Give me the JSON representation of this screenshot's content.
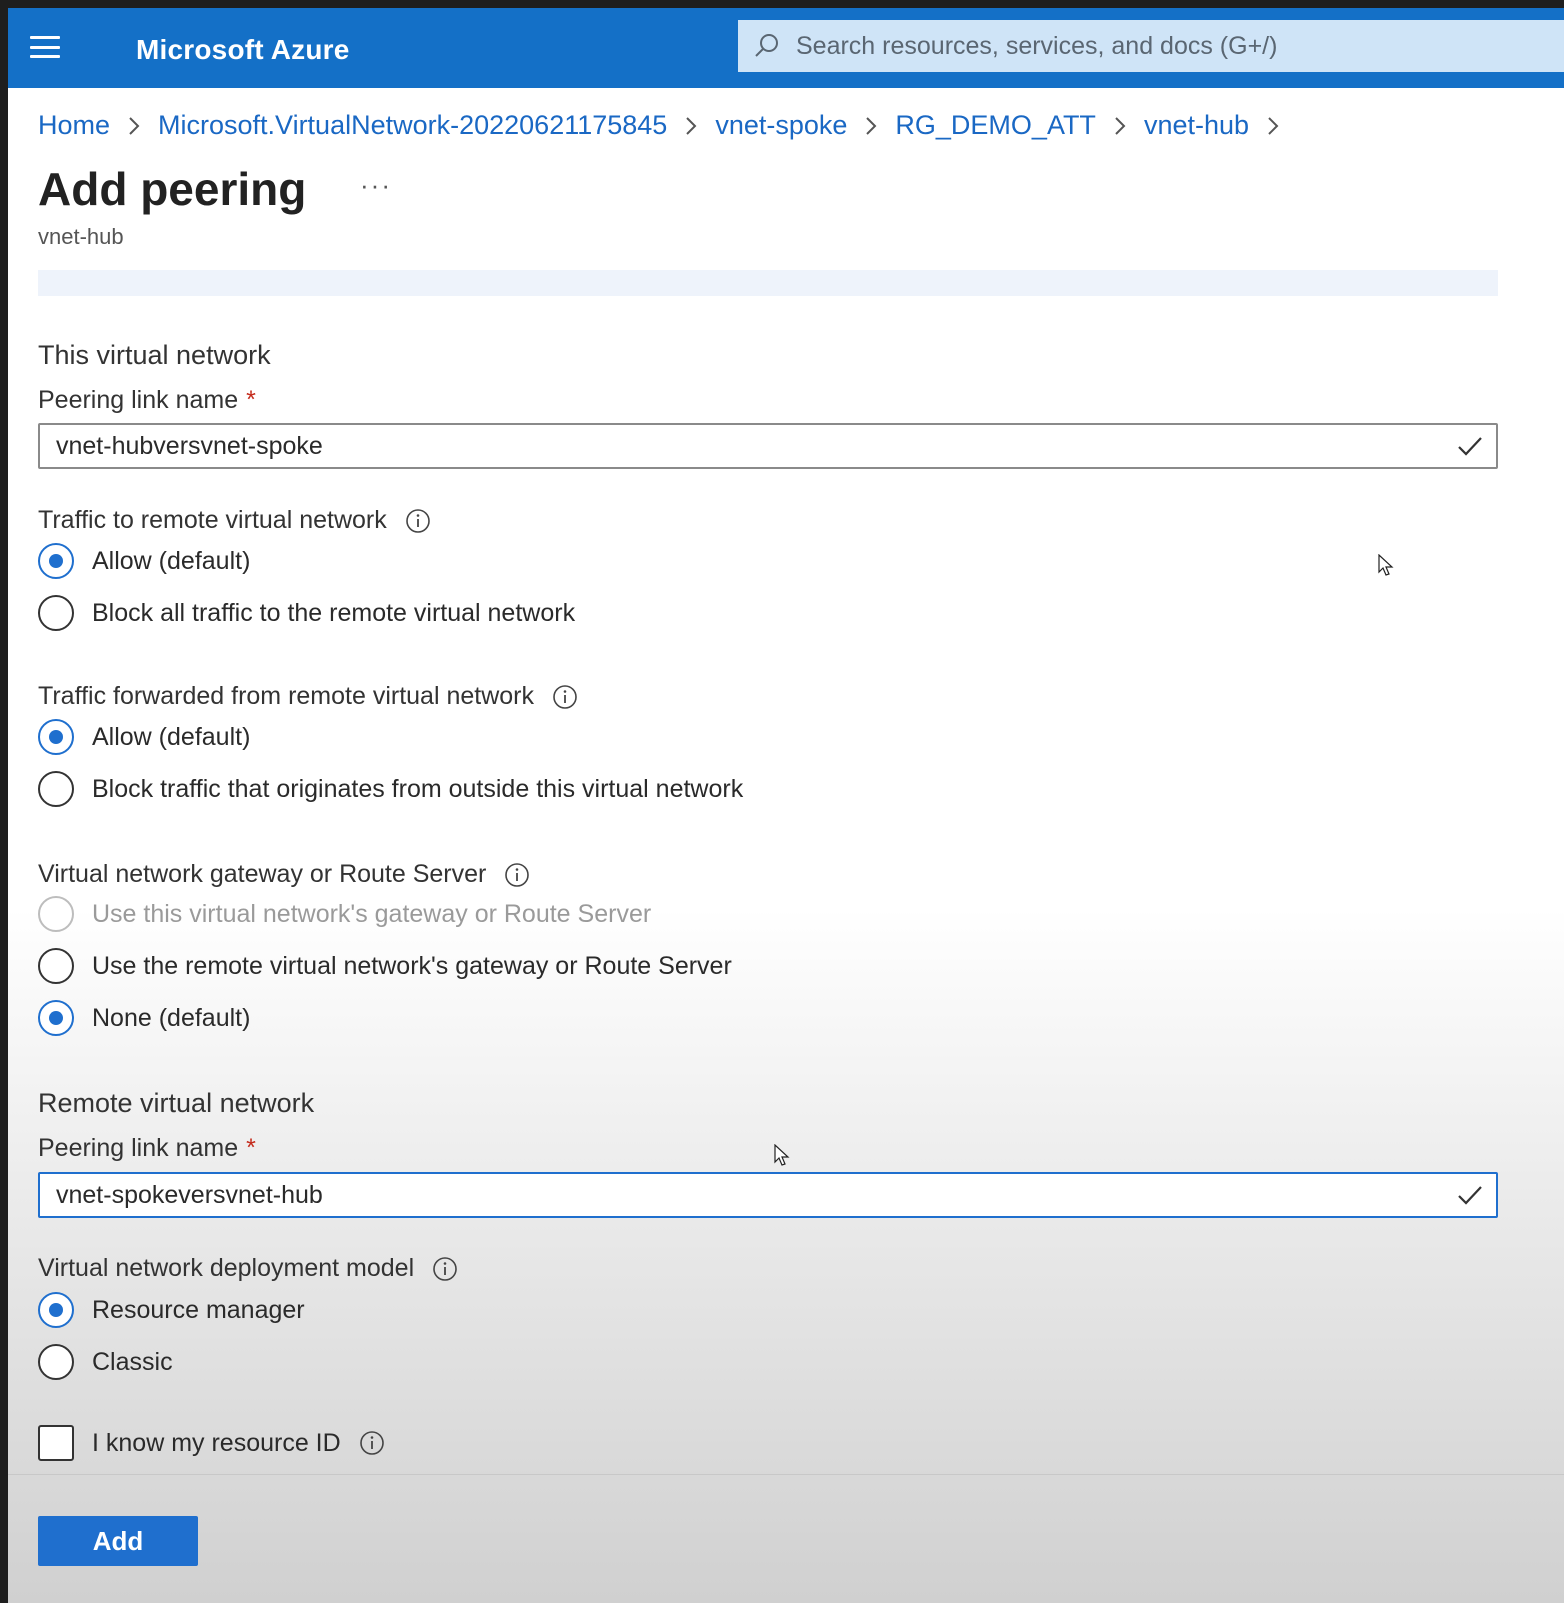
{
  "header": {
    "brand": "Microsoft Azure",
    "search_placeholder": "Search resources, services, and docs (G+/)"
  },
  "breadcrumb": [
    "Home",
    "Microsoft.VirtualNetwork-20220621175845",
    "vnet-spoke",
    "RG_DEMO_ATT",
    "vnet-hub"
  ],
  "page": {
    "title": "Add peering",
    "more": "···",
    "subtitle": "vnet-hub"
  },
  "this_network": {
    "section_title": "This virtual network",
    "link_name_label": "Peering link name",
    "required_mark": "*",
    "link_name_value": "vnet-hubversvnet-spoke",
    "traffic_to_remote": {
      "label": "Traffic to remote virtual network",
      "options": [
        "Allow (default)",
        "Block all traffic to the remote virtual network"
      ],
      "selected": "Allow (default)"
    },
    "traffic_forwarded": {
      "label": "Traffic forwarded from remote virtual network",
      "options": [
        "Allow (default)",
        "Block traffic that originates from outside this virtual network"
      ],
      "selected": "Allow (default)"
    },
    "gateway": {
      "label": "Virtual network gateway or Route Server",
      "options": [
        "Use this virtual network's gateway or Route Server",
        "Use the remote virtual network's gateway or Route Server",
        "None (default)"
      ],
      "selected": "None (default)",
      "disabled": "Use this virtual network's gateway or Route Server"
    }
  },
  "remote_network": {
    "section_title": "Remote virtual network",
    "link_name_label": "Peering link name",
    "required_mark": "*",
    "link_name_value": "vnet-spokeversvnet-hub",
    "deployment_model": {
      "label": "Virtual network deployment model",
      "options": [
        "Resource manager",
        "Classic"
      ],
      "selected": "Resource manager"
    },
    "resource_id_checkbox": "I know my resource ID"
  },
  "actions": {
    "add_label": "Add"
  },
  "colors": {
    "accent": "#1f6fce",
    "topbar": "#1470c7",
    "required": "#c42b1c"
  }
}
